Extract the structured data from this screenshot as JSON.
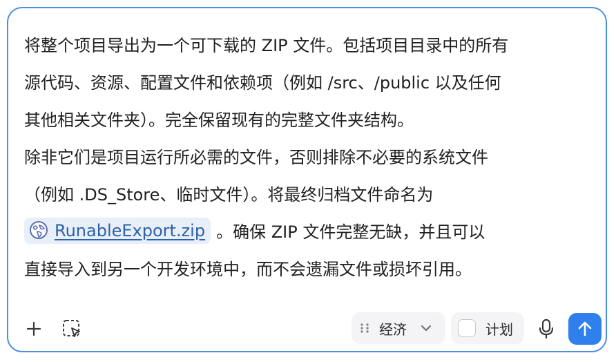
{
  "prompt": {
    "line1": "将整个项目导出为一个可下载的 ZIP 文件。包括项目目录中的所有",
    "line2": "源代码、资源、配置文件和依赖项（例如 /src、/public 以及任何",
    "line3": "其他相关文件夹）。完全保留现有的完整文件夹结构。",
    "line4": "除非它们是项目运行所必需的文件，否则排除不必要的系统文件",
    "line5": "（例如 .DS_Store、临时文件）。将最终归档文件命名为",
    "file_chip": {
      "name": "RunableExport.zip",
      "icon": "globe-icon"
    },
    "line6_after_chip": "。确保 ZIP 文件完整无缺，并且可以",
    "line7": "直接导入到另一个开发环境中，而不会遗漏文件或损坏引用。"
  },
  "toolbar": {
    "add_icon": "plus-icon",
    "select_icon": "region-select-icon",
    "mode": {
      "selected": "经济",
      "icon": "grip-dots-icon",
      "chevron": "chevron-down-icon"
    },
    "plan": {
      "label": "计划",
      "checked": false
    },
    "mic_icon": "microphone-icon",
    "send_icon": "arrow-up-icon"
  },
  "colors": {
    "border": "#4a90e2",
    "chip_bg": "#e8eff8",
    "chip_text": "#2e62a8",
    "send_bg": "#2f80ed",
    "control_bg": "#f4f4f6"
  }
}
